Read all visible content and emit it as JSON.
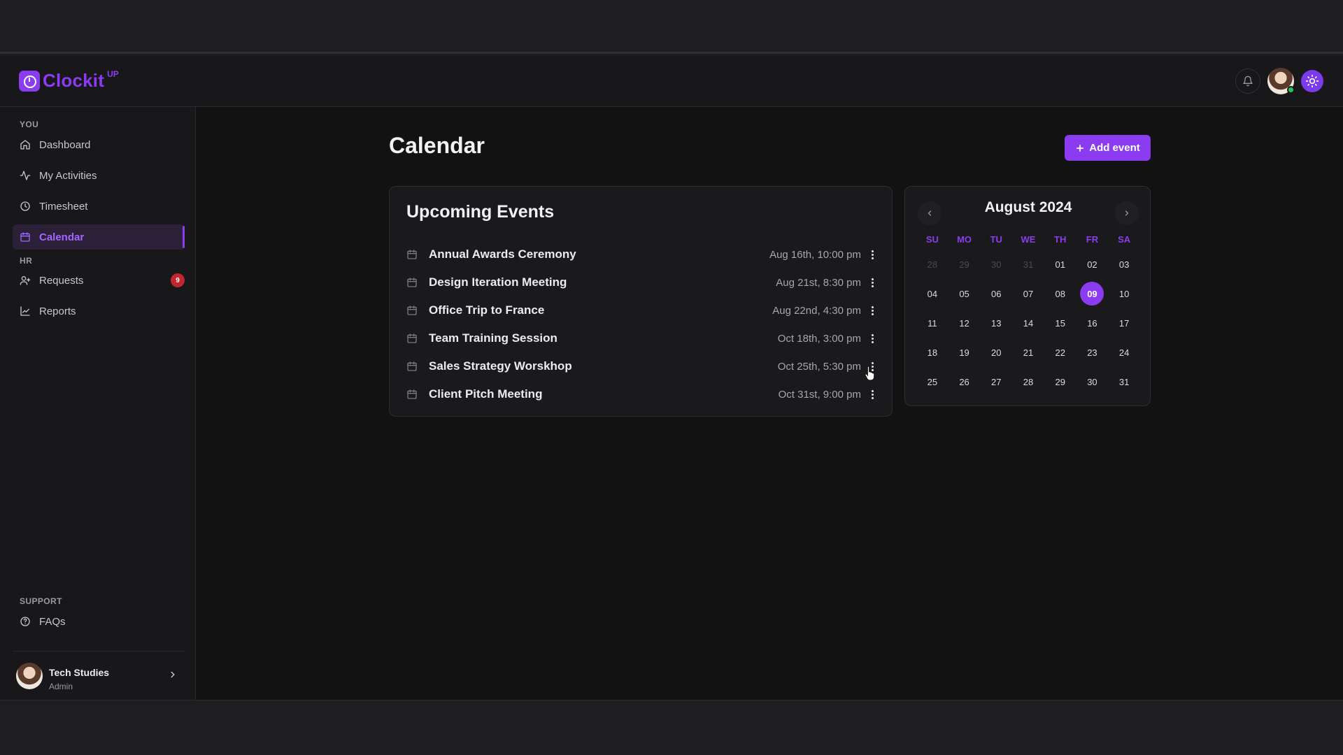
{
  "app": {
    "logo_text": "Clockit",
    "logo_sup": "UP"
  },
  "sidebar": {
    "section_you": "YOU",
    "section_hr": "HR",
    "section_support": "SUPPORT",
    "items": [
      {
        "label": "Dashboard",
        "icon": "home-icon"
      },
      {
        "label": "My Activities",
        "icon": "activity-icon"
      },
      {
        "label": "Timesheet",
        "icon": "clock-icon"
      },
      {
        "label": "Calendar",
        "icon": "calendar-icon",
        "active": true
      },
      {
        "label": "Requests",
        "icon": "user-plus-icon",
        "badge": "9"
      },
      {
        "label": "Reports",
        "icon": "chart-icon"
      },
      {
        "label": "FAQs",
        "icon": "help-circle-icon"
      }
    ],
    "user": {
      "name": "Tech Studies",
      "role": "Admin"
    }
  },
  "main": {
    "title": "Calendar",
    "add_button": "Add event"
  },
  "events": {
    "title": "Upcoming Events",
    "items": [
      {
        "name": "Annual Awards Ceremony",
        "date": "Aug 16th, 10:00 pm"
      },
      {
        "name": "Design Iteration Meeting",
        "date": "Aug 21st, 8:30 pm"
      },
      {
        "name": "Office Trip to France",
        "date": "Aug 22nd, 4:30 pm"
      },
      {
        "name": "Team Training Session",
        "date": "Oct 18th, 3:00 pm"
      },
      {
        "name": "Sales Strategy Worskhop",
        "date": "Oct 25th, 5:30 pm"
      },
      {
        "name": "Client Pitch Meeting",
        "date": "Oct 31st, 9:00 pm"
      }
    ]
  },
  "calendar": {
    "month": "August 2024",
    "weekdays": [
      "SU",
      "MO",
      "TU",
      "WE",
      "TH",
      "FR",
      "SA"
    ],
    "days": [
      {
        "d": "28",
        "muted": true
      },
      {
        "d": "29",
        "muted": true
      },
      {
        "d": "30",
        "muted": true
      },
      {
        "d": "31",
        "muted": true
      },
      {
        "d": "01"
      },
      {
        "d": "02"
      },
      {
        "d": "03"
      },
      {
        "d": "04"
      },
      {
        "d": "05"
      },
      {
        "d": "06"
      },
      {
        "d": "07"
      },
      {
        "d": "08"
      },
      {
        "d": "09",
        "selected": true
      },
      {
        "d": "10"
      },
      {
        "d": "11"
      },
      {
        "d": "12"
      },
      {
        "d": "13"
      },
      {
        "d": "14"
      },
      {
        "d": "15"
      },
      {
        "d": "16"
      },
      {
        "d": "17"
      },
      {
        "d": "18"
      },
      {
        "d": "19"
      },
      {
        "d": "20"
      },
      {
        "d": "21"
      },
      {
        "d": "22"
      },
      {
        "d": "23"
      },
      {
        "d": "24"
      },
      {
        "d": "25"
      },
      {
        "d": "26"
      },
      {
        "d": "27"
      },
      {
        "d": "28"
      },
      {
        "d": "29"
      },
      {
        "d": "30"
      },
      {
        "d": "31"
      }
    ]
  },
  "colors": {
    "accent": "#8b3cf0",
    "badge": "#c0262d",
    "background": "#121213"
  }
}
